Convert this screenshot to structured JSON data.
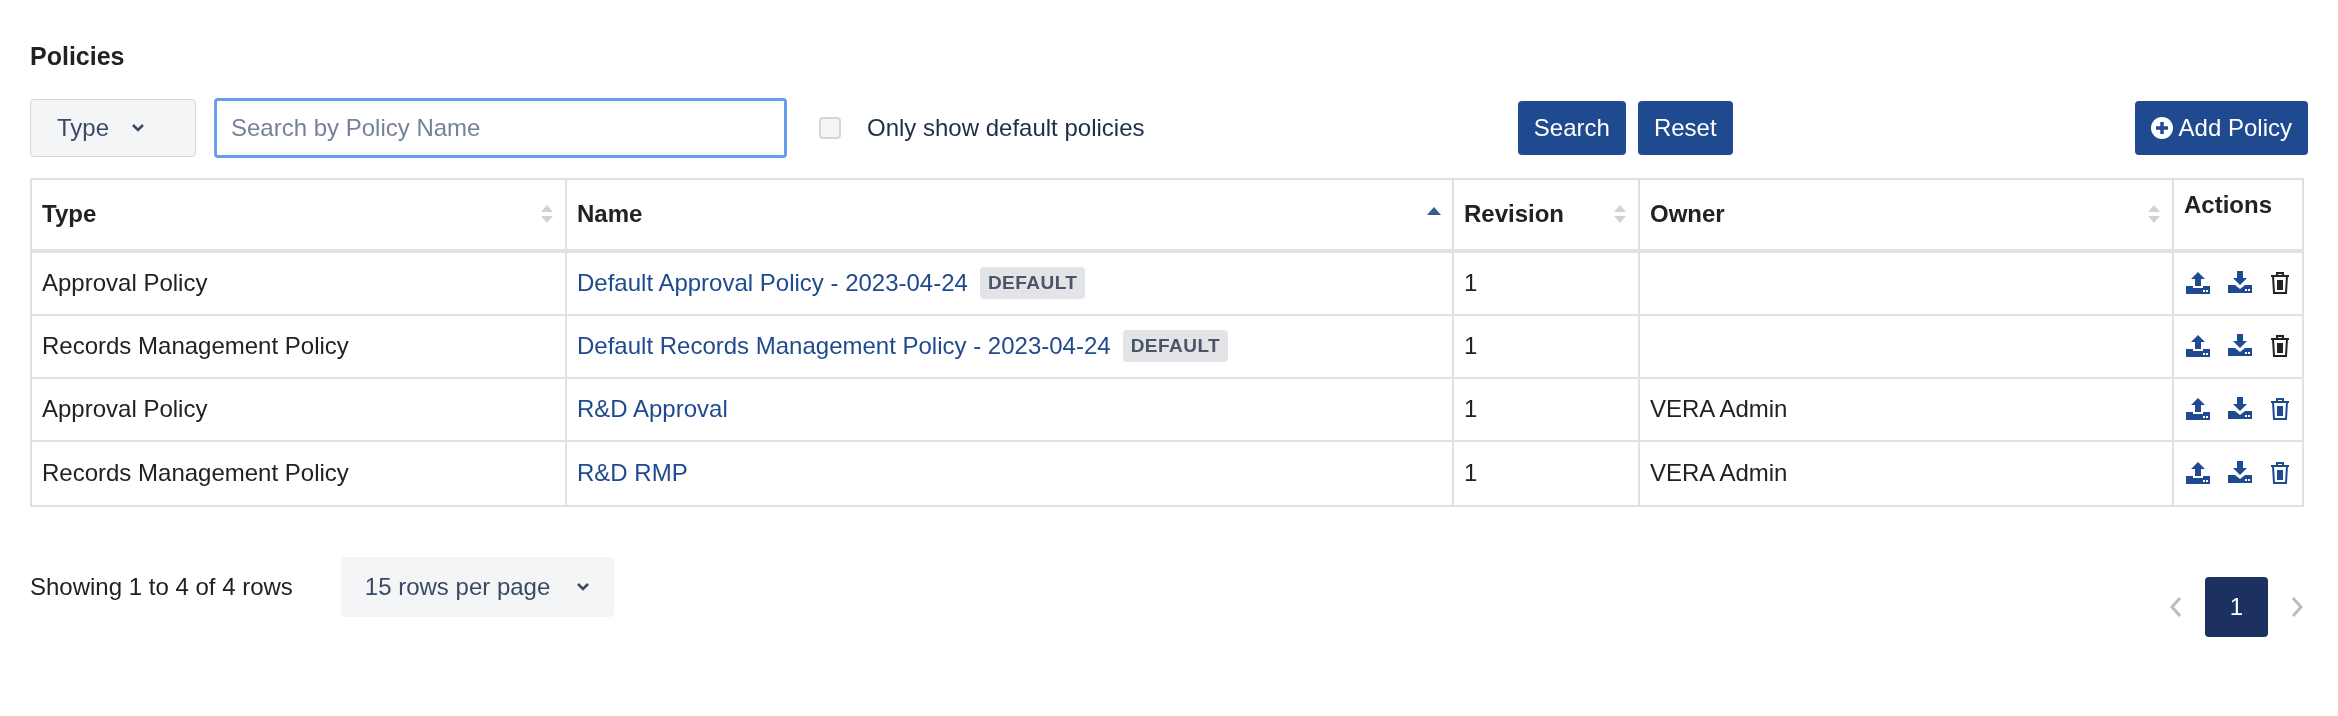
{
  "title": "Policies",
  "toolbar": {
    "type_filter": "Type",
    "search": {
      "placeholder": "Search by Policy Name"
    },
    "default_only": {
      "label": "Only show default policies",
      "checked": false
    },
    "search_button": "Search",
    "reset_button": "Reset",
    "add_button": "Add Policy"
  },
  "table": {
    "columns": [
      {
        "label": "Type",
        "sortable": true,
        "sorted_ascending": false
      },
      {
        "label": "Name",
        "sortable": true,
        "sorted_ascending": true
      },
      {
        "label": "Revision",
        "sortable": true,
        "sorted_ascending": false
      },
      {
        "label": "Owner",
        "sortable": true,
        "sorted_ascending": false
      },
      {
        "label": "Actions",
        "sortable": false
      }
    ],
    "rows": [
      {
        "type": "Approval Policy",
        "name": "Default Approval Policy - 2023-04-24",
        "badge": "DEFAULT",
        "revision": "1",
        "delete_disabled": true
      },
      {
        "type": "Records Management Policy",
        "name": "Default Records Management Policy - 2023-04-24",
        "badge": "DEFAULT",
        "revision": "1",
        "delete_disabled": true
      },
      {
        "type": "Approval Policy",
        "name": "R&D Approval",
        "revision": "1",
        "owner": "VERA Admin",
        "delete_disabled": false
      },
      {
        "type": "Records Management Policy",
        "name": "R&D RMP",
        "revision": "1",
        "owner": "VERA Admin",
        "delete_disabled": false
      }
    ]
  },
  "footer": {
    "summary": "Showing 1 to 4 of 4 rows",
    "page_size": "15 rows per page",
    "pages": [
      {
        "label": "1",
        "selected": true
      }
    ]
  }
}
